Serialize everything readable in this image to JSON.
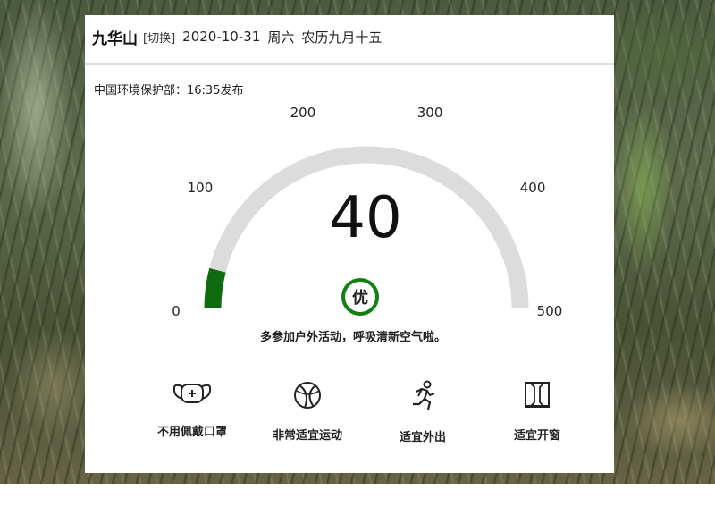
{
  "header": {
    "city": "九华山",
    "switch_label": "[切换]",
    "date": "2020-10-31",
    "weekday": "周六",
    "lunar": "农历九月十五"
  },
  "publish": {
    "text": "中国环境保护部：16:35发布"
  },
  "gauge": {
    "min": 0,
    "max": 500,
    "value": 40,
    "value_text": "40",
    "fill_color": "#0f6b0f",
    "track_color": "#dcdcdc",
    "ticks": [
      "0",
      "100",
      "200",
      "300",
      "400",
      "500"
    ]
  },
  "level": {
    "label": "优",
    "color": "#138013"
  },
  "advice": {
    "text": "多参加户外活动，呼吸清新空气啦。"
  },
  "tips": [
    {
      "icon": "mask-icon",
      "label": "不用佩戴口罩"
    },
    {
      "icon": "basketball-icon",
      "label": "非常适宜运动"
    },
    {
      "icon": "running-person-icon",
      "label": "适宜外出"
    },
    {
      "icon": "window-icon",
      "label": "适宜开窗"
    }
  ]
}
